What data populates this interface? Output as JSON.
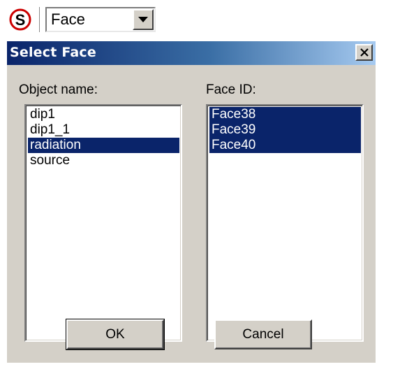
{
  "toolbar": {
    "icon": "s-circle-icon",
    "combo_value": "Face",
    "accent_color": "#cc0000"
  },
  "dialog": {
    "title": "Select Face",
    "object_label": "Object name:",
    "face_label": "Face ID:",
    "objects": [
      {
        "name": "dip1",
        "selected": false
      },
      {
        "name": "dip1_1",
        "selected": false
      },
      {
        "name": "radiation",
        "selected": true
      },
      {
        "name": "source",
        "selected": false
      }
    ],
    "faces": [
      {
        "name": "Face38",
        "selected": true
      },
      {
        "name": "Face39",
        "selected": true
      },
      {
        "name": "Face40",
        "selected": true
      }
    ],
    "ok_label": "OK",
    "cancel_label": "Cancel",
    "selection_color": "#0a246a",
    "title_color": "#0a246a"
  }
}
